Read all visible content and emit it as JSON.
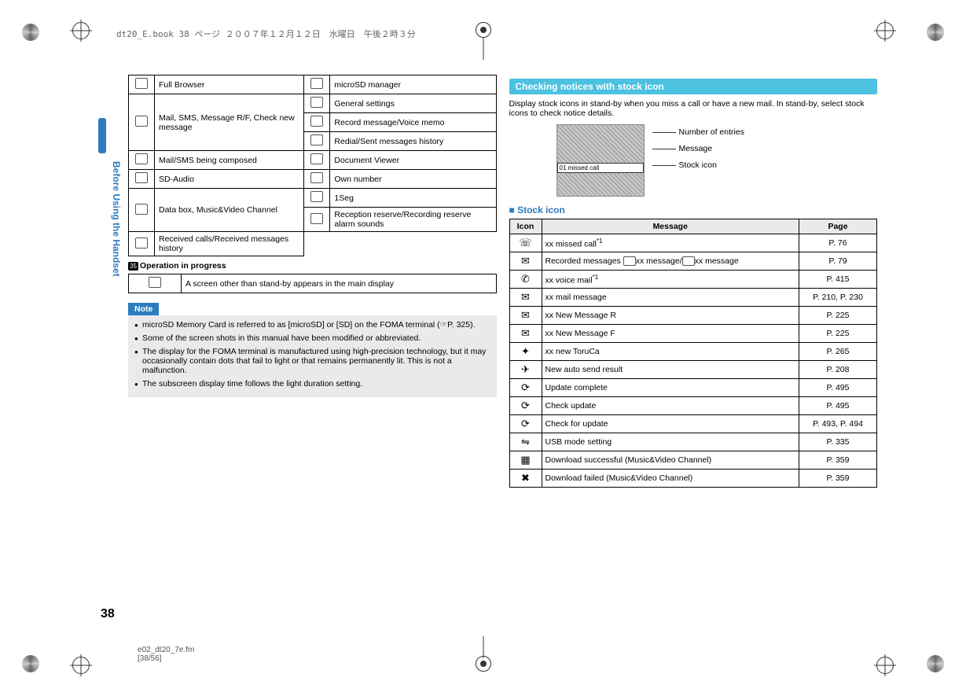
{
  "header_text": "dt20_E.book  38 ページ  ２００７年１２月１２日　水曜日　午後２時３分",
  "sidebar_text": "Before Using the Handset",
  "page_number": "38",
  "footer_fm_line1": "e02_dt20_7e.fm",
  "footer_fm_line2": "[38/56]",
  "left_table": [
    {
      "l": "Full Browser",
      "r": "microSD manager"
    },
    {
      "l": "",
      "r": "General settings"
    },
    {
      "l": "Mail, SMS, Message R/F, Check new message",
      "r": "Record message/Voice memo"
    },
    {
      "l": "",
      "r": "Redial/Sent messages history"
    },
    {
      "l": "Mail/SMS being composed",
      "r": "Document Viewer"
    },
    {
      "l": "SD-Audio",
      "r": "Own number"
    },
    {
      "l": "",
      "r": "1Seg"
    },
    {
      "l": "Data box, Music&Video Channel",
      "r": "Reception reserve/Recording reserve alarm sounds"
    },
    {
      "l": "Received calls/Received messages history",
      "r": ""
    }
  ],
  "op_num": "35",
  "op_heading": "Operation in progress",
  "op_row": "A screen other than stand-by appears in the main display",
  "note_label": "Note",
  "notes": [
    "microSD Memory Card is referred to as [microSD] or [SD] on the FOMA terminal (☞P. 325).",
    "Some of the screen shots in this manual have been modified or abbreviated.",
    "The display for the FOMA terminal is manufactured using high-precision technology, but it may occasionally contain dots that fail to light or that remains permanently lit. This is not a malfunction.",
    "The subscreen display time follows the light duration setting."
  ],
  "right_heading": "Checking notices with stock icon",
  "right_body": "Display stock icons in stand-by when you miss a call or have a new mail. In stand-by, select stock icons to check notice details.",
  "illus_banner": "01 missed call",
  "callouts": [
    "Number of entries",
    "Message",
    "Stock icon"
  ],
  "sub_heading": "Stock icon",
  "stock_head": {
    "icon": "Icon",
    "msg": "Message",
    "pg": "Page"
  },
  "stock_rows": [
    {
      "glyph": "☏",
      "msg_pre": "xx missed call",
      "sup": "*1",
      "msg_post": "",
      "pg": "P. 76"
    },
    {
      "glyph": "✉",
      "msg_pre": "Recorded messages ",
      "inline1": true,
      "mid": "xx message/",
      "inline2": true,
      "msg_post": "xx message",
      "pg": "P. 79"
    },
    {
      "glyph": "✆",
      "msg_pre": "xx voice mail",
      "sup": "*1",
      "msg_post": "",
      "pg": "P. 415"
    },
    {
      "glyph": "✉",
      "msg_pre": "xx mail message",
      "msg_post": "",
      "pg": "P. 210, P. 230"
    },
    {
      "glyph": "✉",
      "msg_pre": "xx New Message R",
      "msg_post": "",
      "pg": "P. 225"
    },
    {
      "glyph": "✉",
      "msg_pre": "xx New Message F",
      "msg_post": "",
      "pg": "P. 225"
    },
    {
      "glyph": "✦",
      "msg_pre": "xx new ToruCa",
      "msg_post": "",
      "pg": "P. 265"
    },
    {
      "glyph": "✈",
      "msg_pre": "New auto send result",
      "msg_post": "",
      "pg": "P. 208"
    },
    {
      "glyph": "⟳",
      "msg_pre": "Update complete",
      "msg_post": "",
      "pg": "P. 495"
    },
    {
      "glyph": "⟳",
      "msg_pre": "Check update",
      "msg_post": "",
      "pg": "P. 495"
    },
    {
      "glyph": "⟳",
      "msg_pre": "Check for update",
      "msg_post": "",
      "pg": "P. 493, P. 494"
    },
    {
      "glyph": "⇋",
      "msg_pre": "USB mode setting",
      "msg_post": "",
      "pg": "P. 335"
    },
    {
      "glyph": "▦",
      "msg_pre": "Download successful (Music&Video Channel)",
      "msg_post": "",
      "pg": "P. 359"
    },
    {
      "glyph": "✖",
      "msg_pre": "Download failed (Music&Video Channel)",
      "msg_post": "",
      "pg": "P. 359"
    }
  ]
}
